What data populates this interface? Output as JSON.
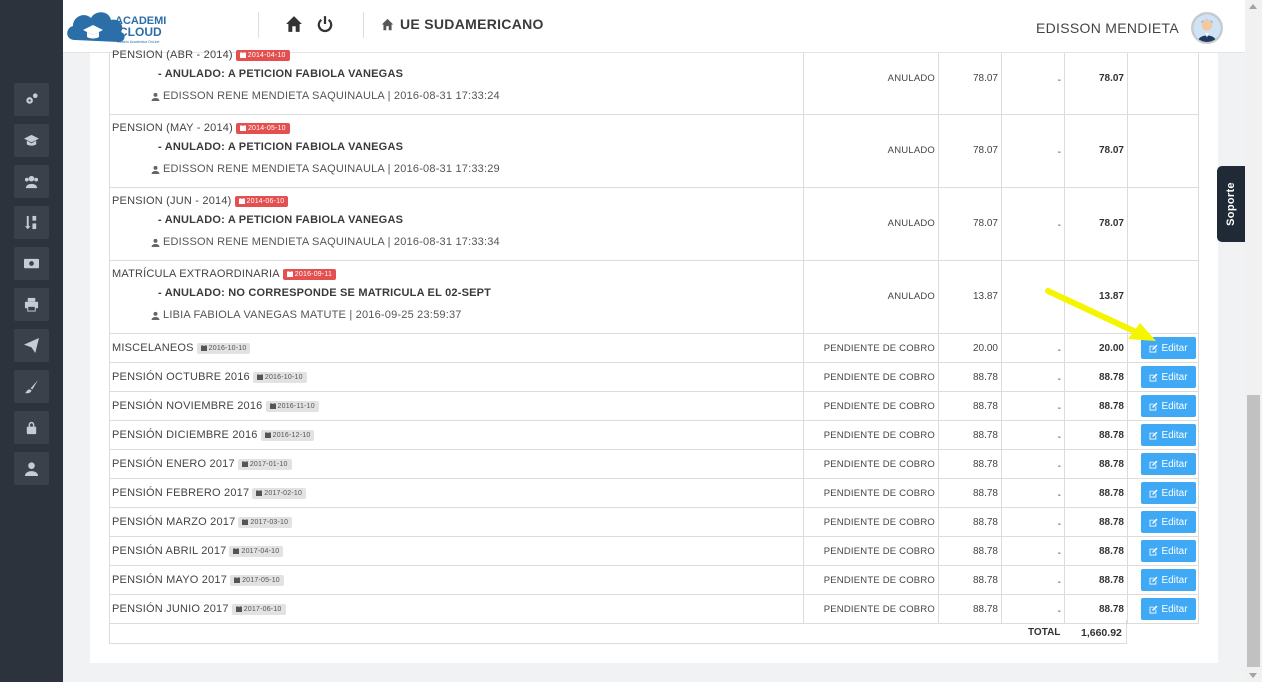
{
  "header": {
    "logo_line1": "ACADEMI",
    "logo_line2": "CLOUD",
    "logo_tagline": "Gestión Académica OnLine",
    "school_name": "UE SUDAMERICANO",
    "username": "EDISSON MENDIETA",
    "icons": [
      "home-icon",
      "power-icon"
    ]
  },
  "sidebar": {
    "items": [
      {
        "icon": "cogs-icon"
      },
      {
        "icon": "graduation-cap-icon"
      },
      {
        "icon": "users-icon"
      },
      {
        "icon": "sort-numeric-icon"
      },
      {
        "icon": "money-icon"
      },
      {
        "icon": "print-icon"
      },
      {
        "icon": "paper-plane-icon"
      },
      {
        "icon": "brush-icon"
      },
      {
        "icon": "lock-icon"
      },
      {
        "icon": "user-icon"
      }
    ]
  },
  "cancelled_rows": [
    {
      "title": "PENSION (ABR - 2014)",
      "date": "2014-04-10",
      "reason": "- ANULADO: A PETICION FABIOLA VANEGAS",
      "user": "EDISSON RENE MENDIETA SAQUINAULA | 2016-08-31 17:33:24",
      "status": "ANULADO",
      "value": "78.07",
      "discount": "-",
      "total": "78.07"
    },
    {
      "title": "PENSION (MAY - 2014)",
      "date": "2014-05-10",
      "reason": "- ANULADO: A PETICION FABIOLA VANEGAS",
      "user": "EDISSON RENE MENDIETA SAQUINAULA | 2016-08-31 17:33:29",
      "status": "ANULADO",
      "value": "78.07",
      "discount": "-",
      "total": "78.07"
    },
    {
      "title": "PENSION (JUN - 2014)",
      "date": "2014-06-10",
      "reason": "- ANULADO: A PETICION FABIOLA VANEGAS",
      "user": "EDISSON RENE MENDIETA SAQUINAULA | 2016-08-31 17:33:34",
      "status": "ANULADO",
      "value": "78.07",
      "discount": "-",
      "total": "78.07"
    },
    {
      "title": "MATRÍCULA EXTRAORDINARIA",
      "date": "2016-09-11",
      "reason": "- ANULADO: NO CORRESPONDE SE MATRICULA EL 02-SEPT",
      "user": "LIBIA FABIOLA VANEGAS MATUTE | 2016-09-25 23:59:37",
      "status": "ANULADO",
      "value": "13.87",
      "discount": "-",
      "total": "13.87"
    }
  ],
  "pending_rows": [
    {
      "title": "MISCELANEOS",
      "date": "2016-10-10",
      "status": "PENDIENTE DE COBRO",
      "value": "20.00",
      "discount": "-",
      "total": "20.00",
      "action": "Editar"
    },
    {
      "title": "PENSIÓN OCTUBRE 2016",
      "date": "2016-10-10",
      "status": "PENDIENTE DE COBRO",
      "value": "88.78",
      "discount": "-",
      "total": "88.78",
      "action": "Editar"
    },
    {
      "title": "PENSIÓN NOVIEMBRE 2016",
      "date": "2016-11-10",
      "status": "PENDIENTE DE COBRO",
      "value": "88.78",
      "discount": "-",
      "total": "88.78",
      "action": "Editar"
    },
    {
      "title": "PENSIÓN DICIEMBRE 2016",
      "date": "2016-12-10",
      "status": "PENDIENTE DE COBRO",
      "value": "88.78",
      "discount": "-",
      "total": "88.78",
      "action": "Editar"
    },
    {
      "title": "PENSIÓN ENERO 2017",
      "date": "2017-01-10",
      "status": "PENDIENTE DE COBRO",
      "value": "88.78",
      "discount": "-",
      "total": "88.78",
      "action": "Editar"
    },
    {
      "title": "PENSIÓN FEBRERO 2017",
      "date": "2017-02-10",
      "status": "PENDIENTE DE COBRO",
      "value": "88.78",
      "discount": "-",
      "total": "88.78",
      "action": "Editar"
    },
    {
      "title": "PENSIÓN MARZO 2017",
      "date": "2017-03-10",
      "status": "PENDIENTE DE COBRO",
      "value": "88.78",
      "discount": "-",
      "total": "88.78",
      "action": "Editar"
    },
    {
      "title": "PENSIÓN ABRIL 2017",
      "date": "2017-04-10",
      "status": "PENDIENTE DE COBRO",
      "value": "88.78",
      "discount": "-",
      "total": "88.78",
      "action": "Editar"
    },
    {
      "title": "PENSIÓN MAYO 2017",
      "date": "2017-05-10",
      "status": "PENDIENTE DE COBRO",
      "value": "88.78",
      "discount": "-",
      "total": "88.78",
      "action": "Editar"
    },
    {
      "title": "PENSIÓN JUNIO 2017",
      "date": "2017-06-10",
      "status": "PENDIENTE DE COBRO",
      "value": "88.78",
      "discount": "-",
      "total": "88.78",
      "action": "Editar"
    }
  ],
  "total": {
    "label": "TOTAL",
    "value": "1,660.92"
  },
  "support_tab": "Soporte",
  "colors": {
    "accent": "#3fa9f5",
    "cancel_badge": "#e44f4f",
    "sidebar": "#2d333c",
    "arrow": "#f5f500"
  }
}
